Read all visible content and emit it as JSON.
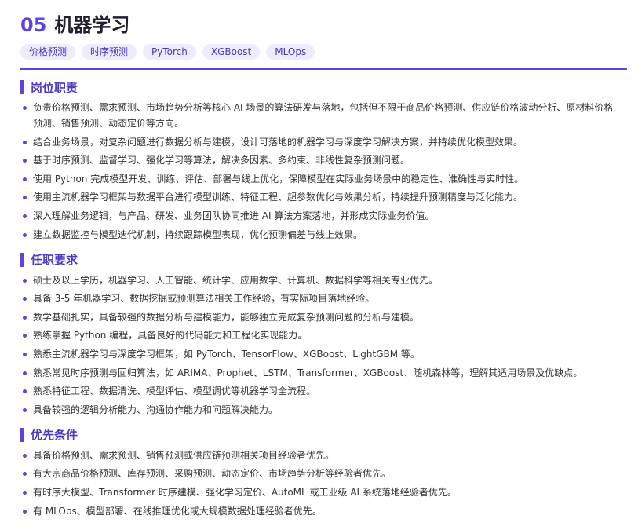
{
  "header": {
    "number": "05",
    "title": "机器学习",
    "tags": [
      "价格预测",
      "时序预测",
      "PyTorch",
      "XGBoost",
      "MLOps"
    ]
  },
  "sections": [
    {
      "title": "岗位职责",
      "items": [
        "负责价格预测、需求预测、市场趋势分析等核心 AI 场景的算法研发与落地，包括但不限于商品价格预测、供应链价格波动分析、原材料价格预测、销售预测、动态定价等方向。",
        "结合业务场景，对复杂问题进行数据分析与建模，设计可落地的机器学习与深度学习解决方案，并持续优化模型效果。",
        "基于时序预测、监督学习、强化学习等算法，解决多因素、多约束、非线性复杂预测问题。",
        "使用 Python 完成模型开发、训练、评估、部署与线上优化，保障模型在实际业务场景中的稳定性、准确性与实时性。",
        "使用主流机器学习框架与数据平台进行模型训练、特征工程、超参数优化与效果分析，持续提升预测精度与泛化能力。",
        "深入理解业务逻辑，与产品、研发、业务团队协同推进 AI 算法方案落地，并形成实际业务价值。",
        "建立数据监控与模型迭代机制，持续跟踪模型表现，优化预测偏差与线上效果。"
      ]
    },
    {
      "title": "任职要求",
      "items": [
        "硕士及以上学历，机器学习、人工智能、统计学、应用数学、计算机、数据科学等相关专业优先。",
        "具备 3-5 年机器学习、数据挖掘或预测算法相关工作经验，有实际项目落地经验。",
        "数学基础扎实，具备较强的数据分析与建模能力，能够独立完成复杂预测问题的分析与建模。",
        "熟练掌握 Python 编程，具备良好的代码能力和工程化实现能力。",
        "熟悉主流机器学习与深度学习框架，如 PyTorch、TensorFlow、XGBoost、LightGBM 等。",
        "熟悉常见时序预测与回归算法，如 ARIMA、Prophet、LSTM、Transformer、XGBoost、随机森林等，理解其适用场景及优缺点。",
        "熟悉特征工程、数据清洗、模型评估、模型调优等机器学习全流程。",
        "具备较强的逻辑分析能力、沟通协作能力和问题解决能力。"
      ]
    },
    {
      "title": "优先条件",
      "items": [
        "具备价格预测、需求预测、销售预测或供应链预测相关项目经验者优先。",
        "有大宗商品价格预测、库存预测、采购预测、动态定价、市场趋势分析等经验者优先。",
        "有时序大模型、Transformer 时序建模、强化学习定价、AutoML 或工业级 AI 系统落地经验者优先。",
        "有 MLOps、模型部署、在线推理优化或大规模数据处理经验者优先。"
      ]
    }
  ],
  "colors": {
    "accent": "#5b45e0",
    "tag_bg": "#eeebfb",
    "text": "#333333"
  }
}
